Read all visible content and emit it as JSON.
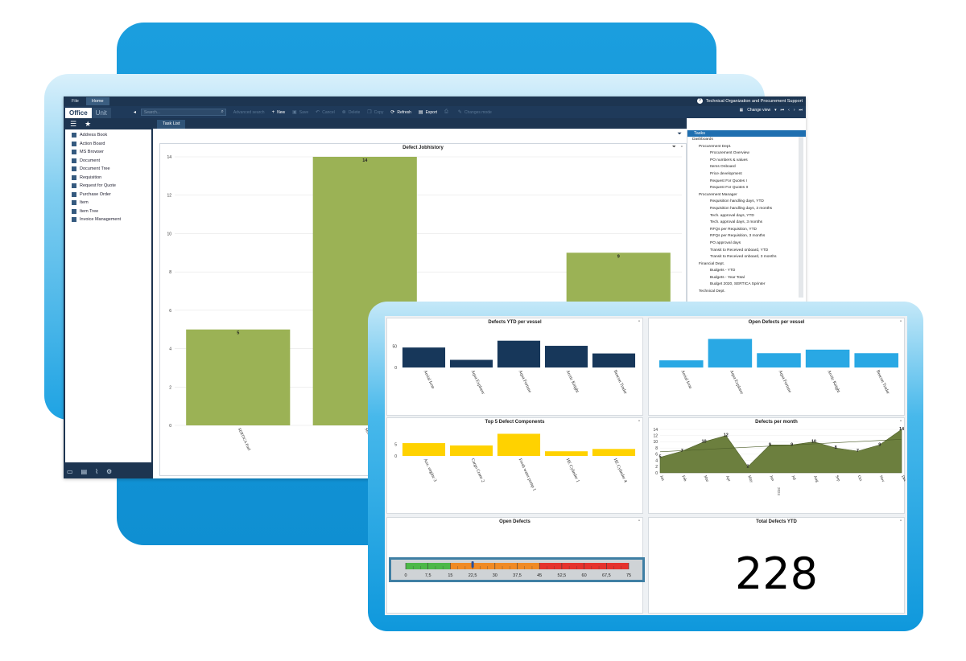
{
  "menubar": {
    "tabs": [
      "File",
      "Home"
    ],
    "help": "Technical Organization and Procurement Support"
  },
  "toolbar": {
    "office": "Office",
    "unit": "Unit",
    "search_placeholder": "Search...",
    "buttons": [
      {
        "label": "Advanced search",
        "dim": true,
        "icon": ""
      },
      {
        "label": "New",
        "dim": false,
        "icon": "+"
      },
      {
        "label": "Save",
        "dim": true,
        "icon": "▣"
      },
      {
        "label": "Cancel",
        "dim": true,
        "icon": "↶"
      },
      {
        "label": "Delete",
        "dim": true,
        "icon": "⊗"
      },
      {
        "label": "Copy",
        "dim": true,
        "icon": "❐"
      },
      {
        "label": "Refresh",
        "dim": false,
        "icon": "⟳"
      },
      {
        "label": "Export",
        "dim": false,
        "icon": "▤"
      },
      {
        "label": "",
        "dim": true,
        "icon": "⎙"
      },
      {
        "label": "Changes mode",
        "dim": true,
        "icon": "✎"
      }
    ],
    "change_view": "Change view"
  },
  "sidebar": {
    "items": [
      {
        "label": "Address Book",
        "icon": "address-book-icon"
      },
      {
        "label": "Action Board",
        "icon": "action-board-icon"
      },
      {
        "label": "MS Browser",
        "icon": "ms-browser-icon"
      },
      {
        "label": "Document",
        "icon": "document-icon"
      },
      {
        "label": "Document Tree",
        "icon": "document-tree-icon"
      },
      {
        "label": "Requisition",
        "icon": "cart-icon"
      },
      {
        "label": "Request for Quote",
        "icon": "quote-icon"
      },
      {
        "label": "Purchase Order",
        "icon": "purchase-order-icon"
      },
      {
        "label": "Item",
        "icon": "wrench-icon"
      },
      {
        "label": "Item Tree",
        "icon": "wrench-icon"
      },
      {
        "label": "Invoice Management",
        "icon": "invoice-icon"
      }
    ]
  },
  "doc_tab": "Task List",
  "tasks": {
    "header": "Tasks",
    "tree": [
      {
        "label": "Dashboards",
        "level": 0
      },
      {
        "label": "Procurement Dept.",
        "level": 1
      },
      {
        "label": "Procurement Overview",
        "level": 2
      },
      {
        "label": "PO numbers & values",
        "level": 2
      },
      {
        "label": "Items Onboard",
        "level": 2
      },
      {
        "label": "Price development",
        "level": 2
      },
      {
        "label": "Request For Quotes I",
        "level": 2
      },
      {
        "label": "Request For Quotes II",
        "level": 2
      },
      {
        "label": "Procurement Manager",
        "level": 1
      },
      {
        "label": "Requisition handling days, YTD",
        "level": 2
      },
      {
        "label": "Requisition handling days, 3 months",
        "level": 2
      },
      {
        "label": "Tech. approval days, YTD",
        "level": 2
      },
      {
        "label": "Tech. approval days, 3 months",
        "level": 2
      },
      {
        "label": "RFQs per Requisition, YTD",
        "level": 2
      },
      {
        "label": "RFQs per Requisition, 3 months",
        "level": 2
      },
      {
        "label": "PO approval days",
        "level": 2
      },
      {
        "label": "Transit to Received onboard, YTD",
        "level": 2
      },
      {
        "label": "Transit to Received onboard, 3 months",
        "level": 2
      },
      {
        "label": "Financial Dept.",
        "level": 1
      },
      {
        "label": "Budgets - YTD",
        "level": 2
      },
      {
        "label": "Budgets - Year Total",
        "level": 2
      },
      {
        "label": "Budget 2020, SERTICA Sprinter",
        "level": 2
      },
      {
        "label": "Technical Dept.",
        "level": 1
      }
    ]
  },
  "chart_data": [
    {
      "id": "defect-jobhistory",
      "type": "bar",
      "title": "Defect Jobhistory",
      "categories": [
        "SERTICA Fuel",
        "SERTICA Ocean",
        "",
        ""
      ],
      "values": [
        5,
        14,
        null,
        9
      ],
      "ylim": [
        0,
        14
      ],
      "yticks": [
        0,
        2,
        4,
        6,
        8,
        10,
        12,
        14
      ],
      "color": "#9bb255",
      "data_labels": true,
      "grid": true
    },
    {
      "id": "defects-ytd-per-vessel",
      "type": "bar",
      "title": "Defects YTD per vessel",
      "categories": [
        "Aerial Icon",
        "Aqua Explorer",
        "Aqua Fortune",
        "Arctic Knight",
        "Beacon Trader"
      ],
      "values": [
        47,
        18,
        63,
        51,
        33
      ],
      "ylim": [
        0,
        70
      ],
      "yticks": [
        0,
        50
      ],
      "color": "#17375a"
    },
    {
      "id": "open-defects-per-vessel",
      "type": "bar",
      "title": "Open Defects per vessel",
      "categories": [
        "Aerial Icon",
        "Aqua Explorer",
        "Aqua Fortune",
        "Arctic Knight",
        "Beacon Trader"
      ],
      "values": [
        3,
        12,
        6,
        7.5,
        6
      ],
      "ylim": [
        0,
        12.5
      ],
      "yticks": [],
      "color": "#29a8e4"
    },
    {
      "id": "top5-defect-components",
      "type": "bar",
      "title": "Top 5 Defect Components",
      "categories": [
        "Aux. engine 3",
        "Cargo Crane 2",
        "Fresh water pump 1",
        "HE Cylinder 1",
        "HE Cylinder 4"
      ],
      "values": [
        5.5,
        4.5,
        9.5,
        2,
        3
      ],
      "ylim": [
        0,
        10
      ],
      "yticks": [
        0,
        5
      ],
      "color": "#ffd200"
    },
    {
      "id": "defects-per-month",
      "type": "area",
      "title": "Defects per month",
      "categories": [
        "Jan",
        "Feb",
        "Mar",
        "Apr",
        "May",
        "Jun",
        "Jul",
        "Aug",
        "Sep",
        "Oct",
        "Nov",
        "Dec"
      ],
      "values": [
        5,
        7,
        10,
        12,
        2,
        9,
        9,
        10,
        8,
        7,
        9,
        14
      ],
      "ylim": [
        0,
        14
      ],
      "yticks": [
        0,
        2,
        4,
        6,
        8,
        10,
        12,
        14
      ],
      "series_label": "2024",
      "color": "#6c7f3e"
    }
  ],
  "gauge": {
    "title": "Open Defects",
    "value": 22.5,
    "min": 0,
    "max": 75,
    "tick_labels": [
      "0",
      "7,5",
      "15",
      "22,5",
      "30",
      "37,5",
      "45",
      "52,5",
      "60",
      "67,5",
      "75"
    ],
    "bands": [
      {
        "from": 0,
        "to": 15,
        "color": "#4cb848"
      },
      {
        "from": 15,
        "to": 45,
        "color": "#f08a24"
      },
      {
        "from": 45,
        "to": 75,
        "color": "#e5322d"
      }
    ]
  },
  "total": {
    "title": "Total Defects YTD",
    "value": "228"
  }
}
